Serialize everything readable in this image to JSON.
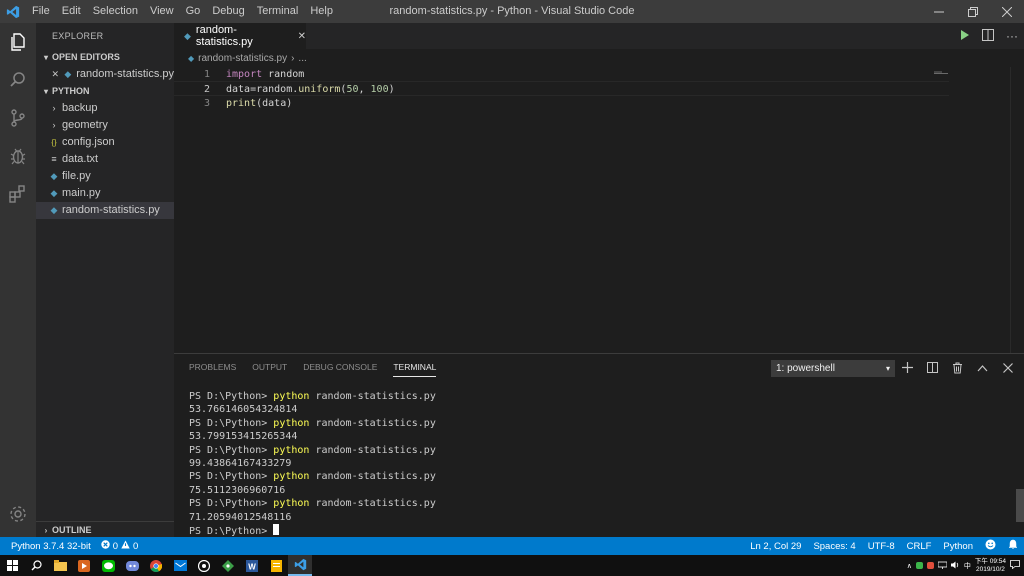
{
  "titlebar": {
    "menu": [
      "File",
      "Edit",
      "Selection",
      "View",
      "Go",
      "Debug",
      "Terminal",
      "Help"
    ],
    "title": "random-statistics.py - Python - Visual Studio Code"
  },
  "sidebar": {
    "header": "EXPLORER",
    "open_editors_label": "OPEN EDITORS",
    "open_editor_file": "random-statistics.py",
    "folder_label": "PYTHON",
    "items": [
      {
        "label": "backup",
        "kind": "folder"
      },
      {
        "label": "geometry",
        "kind": "folder"
      },
      {
        "label": "config.json",
        "kind": "json"
      },
      {
        "label": "data.txt",
        "kind": "txt"
      },
      {
        "label": "file.py",
        "kind": "py"
      },
      {
        "label": "main.py",
        "kind": "py"
      },
      {
        "label": "random-statistics.py",
        "kind": "py",
        "selected": true
      }
    ],
    "outline_label": "OUTLINE"
  },
  "editor": {
    "tab_label": "random-statistics.py",
    "breadcrumb_file": "random-statistics.py",
    "breadcrumb_more": "...",
    "lines": [
      {
        "num": "1",
        "text": "import random"
      },
      {
        "num": "2",
        "text": "data=random.uniform(50, 100)"
      },
      {
        "num": "3",
        "text": "print(data)"
      }
    ]
  },
  "panel": {
    "tabs": [
      "PROBLEMS",
      "OUTPUT",
      "DEBUG CONSOLE",
      "TERMINAL"
    ],
    "active_tab": "TERMINAL",
    "shell_select": "1: powershell",
    "terminal_lines": [
      {
        "prompt": "PS D:\\Python> ",
        "cmd": "python",
        "arg": " random-statistics.py"
      },
      {
        "out": "53.766146054324814"
      },
      {
        "prompt": "PS D:\\Python> ",
        "cmd": "python",
        "arg": " random-statistics.py"
      },
      {
        "out": "53.799153415265344"
      },
      {
        "prompt": "PS D:\\Python> ",
        "cmd": "python",
        "arg": " random-statistics.py"
      },
      {
        "out": "99.43864167433279"
      },
      {
        "prompt": "PS D:\\Python> ",
        "cmd": "python",
        "arg": " random-statistics.py"
      },
      {
        "out": "75.5112306960716"
      },
      {
        "prompt": "PS D:\\Python> ",
        "cmd": "python",
        "arg": " random-statistics.py"
      },
      {
        "out": "71.20594012548116"
      },
      {
        "prompt": "PS D:\\Python> ",
        "cursor": true
      }
    ]
  },
  "status": {
    "interpreter": "Python 3.7.4 32-bit",
    "errors": "0",
    "warnings": "0",
    "position": "Ln 2, Col 29",
    "spaces": "Spaces: 4",
    "encoding": "UTF-8",
    "eol": "CRLF",
    "language": "Python"
  },
  "taskbar": {
    "ime": "中",
    "time": "下午 09:54",
    "date": "2019/10/2"
  },
  "colors": {
    "accent": "#007acc",
    "keyword": "#c586c0",
    "function": "#dcdcaa",
    "number": "#b5cea8",
    "terminal_command": "#ffff55"
  }
}
